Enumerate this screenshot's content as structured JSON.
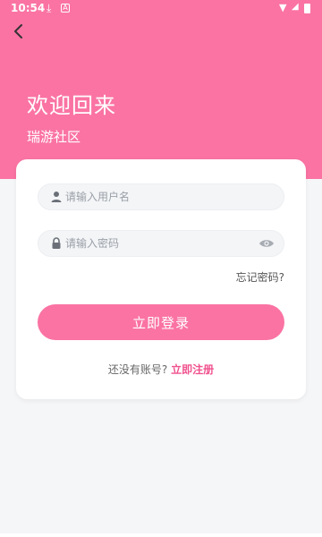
{
  "status_bar": {
    "time": "10:54",
    "download_icon": "download-icon",
    "notification_icon": "a-icon"
  },
  "header": {
    "back_icon": "chevron-left-icon",
    "title": "欢迎回来",
    "subtitle": "瑞游社区",
    "bg_color": "#fa73a3"
  },
  "form": {
    "username_placeholder": "请输入用户名",
    "password_placeholder": "请输入密码",
    "forgot_label": "忘记密码?",
    "login_label": "立即登录",
    "register_prompt": "还没有账号?",
    "register_link": "立即注册",
    "accent_color": "#fa73a3"
  }
}
